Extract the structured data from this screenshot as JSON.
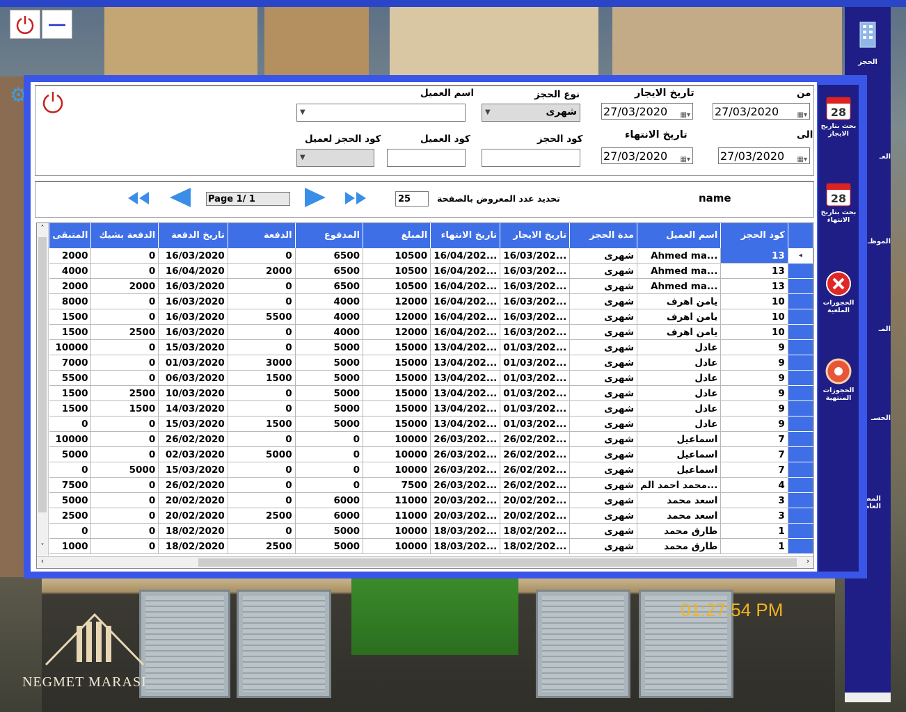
{
  "window": {
    "power_icon": "power-icon",
    "minimize_icon": "minimize-icon"
  },
  "right_nav": {
    "items": [
      {
        "label": "الحجز",
        "icon": "building-icon"
      },
      {
        "label": "العـ",
        "icon": ""
      },
      {
        "label": "الموظـ",
        "icon": ""
      },
      {
        "label": "المـ",
        "icon": ""
      },
      {
        "label": "الحسـ",
        "icon": ""
      },
      {
        "label": "المصرو العامة",
        "icon": ""
      }
    ]
  },
  "side_nav": {
    "items": [
      {
        "label": "بحث بتاريخ الايجار",
        "icon": "calendar-icon"
      },
      {
        "label": "بحث بتاريخ الانتهاء",
        "icon": "calendar-icon"
      },
      {
        "label": "الحجوزات الملغية",
        "icon": "cancel-icon"
      },
      {
        "label": "الحجوزات المنتهية",
        "icon": "stop-icon"
      }
    ]
  },
  "filters": {
    "from_label": "من",
    "to_label": "الى",
    "from_date": "27/03/2020",
    "to_date": "27/03/2020",
    "rent_date_label": "تاريخ الايجار",
    "end_date_label": "تاريخ الانتهاء",
    "rent_date": "27/03/2020",
    "end_date": "27/03/2020",
    "booking_type_label": "نوع الحجز",
    "booking_type_value": "شهرى",
    "customer_name_label": "اسم العميل",
    "booking_code_label": "كود الحجز",
    "customer_code_label": "كود العميل",
    "customer_booking_code_label": "كود الحجز لعميل"
  },
  "pager": {
    "page_text": "Page 1/ 1",
    "page_size": "25",
    "page_size_label": "تحديد عدد المعروض بالصفحة",
    "name_label": "name"
  },
  "table": {
    "columns": [
      "كود الحجز",
      "اسم العميل",
      "مدة الحجز",
      "تاريخ الايجار",
      "تاريخ الانتهاء",
      "المبلغ",
      "المدفوع",
      "الدفعة",
      "تاريخ الدفعة",
      "الدفعة بشيك",
      "المتبقى"
    ],
    "rows": [
      [
        "13",
        "Ahmed ma...",
        "شهرى",
        "16/03/202...",
        "16/04/202...",
        "10500",
        "6500",
        "0",
        "16/03/2020",
        "0",
        "2000"
      ],
      [
        "13",
        "Ahmed ma...",
        "شهرى",
        "16/03/202...",
        "16/04/202...",
        "10500",
        "6500",
        "2000",
        "16/04/2020",
        "0",
        "4000"
      ],
      [
        "13",
        "Ahmed ma...",
        "شهرى",
        "16/03/202...",
        "16/04/202...",
        "10500",
        "6500",
        "0",
        "16/03/2020",
        "2000",
        "2000"
      ],
      [
        "10",
        "يامن اهرف",
        "شهرى",
        "16/03/202...",
        "16/04/202...",
        "12000",
        "4000",
        "0",
        "16/03/2020",
        "0",
        "8000"
      ],
      [
        "10",
        "يامن اهرف",
        "شهرى",
        "16/03/202...",
        "16/04/202...",
        "12000",
        "4000",
        "5500",
        "16/03/2020",
        "0",
        "1500"
      ],
      [
        "10",
        "يامن اهرف",
        "شهرى",
        "16/03/202...",
        "16/04/202...",
        "12000",
        "4000",
        "0",
        "16/03/2020",
        "2500",
        "1500"
      ],
      [
        "9",
        "عادل",
        "شهرى",
        "01/03/202...",
        "13/04/202...",
        "15000",
        "5000",
        "0",
        "15/03/2020",
        "0",
        "10000"
      ],
      [
        "9",
        "عادل",
        "شهرى",
        "01/03/202...",
        "13/04/202...",
        "15000",
        "5000",
        "3000",
        "01/03/2020",
        "0",
        "7000"
      ],
      [
        "9",
        "عادل",
        "شهرى",
        "01/03/202...",
        "13/04/202...",
        "15000",
        "5000",
        "1500",
        "06/03/2020",
        "0",
        "5500"
      ],
      [
        "9",
        "عادل",
        "شهرى",
        "01/03/202...",
        "13/04/202...",
        "15000",
        "5000",
        "0",
        "10/03/2020",
        "2500",
        "1500"
      ],
      [
        "9",
        "عادل",
        "شهرى",
        "01/03/202...",
        "13/04/202...",
        "15000",
        "5000",
        "0",
        "14/03/2020",
        "1500",
        "1500"
      ],
      [
        "9",
        "عادل",
        "شهرى",
        "01/03/202...",
        "13/04/202...",
        "15000",
        "5000",
        "1500",
        "15/03/2020",
        "0",
        "0"
      ],
      [
        "7",
        "اسماعيل",
        "شهرى",
        "26/02/202...",
        "26/03/202...",
        "10000",
        "0",
        "0",
        "26/02/2020",
        "0",
        "10000"
      ],
      [
        "7",
        "اسماعيل",
        "شهرى",
        "26/02/202...",
        "26/03/202...",
        "10000",
        "0",
        "5000",
        "02/03/2020",
        "0",
        "5000"
      ],
      [
        "7",
        "اسماعيل",
        "شهرى",
        "26/02/202...",
        "26/03/202...",
        "10000",
        "0",
        "0",
        "15/03/2020",
        "5000",
        "0"
      ],
      [
        "4",
        "محمد احمد الم...",
        "شهرى",
        "26/02/202...",
        "26/03/202...",
        "7500",
        "0",
        "0",
        "26/02/2020",
        "0",
        "7500"
      ],
      [
        "3",
        "اسعد محمد",
        "شهرى",
        "20/02/202...",
        "20/03/202...",
        "11000",
        "6000",
        "0",
        "20/02/2020",
        "0",
        "5000"
      ],
      [
        "3",
        "اسعد محمد",
        "شهرى",
        "20/02/202...",
        "20/03/202...",
        "11000",
        "6000",
        "2500",
        "20/02/2020",
        "0",
        "2500"
      ],
      [
        "1",
        "طارق محمد",
        "شهرى",
        "18/02/202...",
        "18/03/202...",
        "10000",
        "5000",
        "0",
        "18/02/2020",
        "0",
        "0"
      ],
      [
        "1",
        "طارق محمد",
        "شهرى",
        "18/02/202...",
        "18/03/202...",
        "10000",
        "5000",
        "2500",
        "18/02/2020",
        "0",
        "1000"
      ]
    ]
  },
  "clock": "01:27:54 PM",
  "brand": "NEGMET MARASI",
  "colors": {
    "accent": "#3f6fe6",
    "panel": "#3a56e8",
    "nav": "#1e1e86",
    "clock": "#f0b420"
  }
}
